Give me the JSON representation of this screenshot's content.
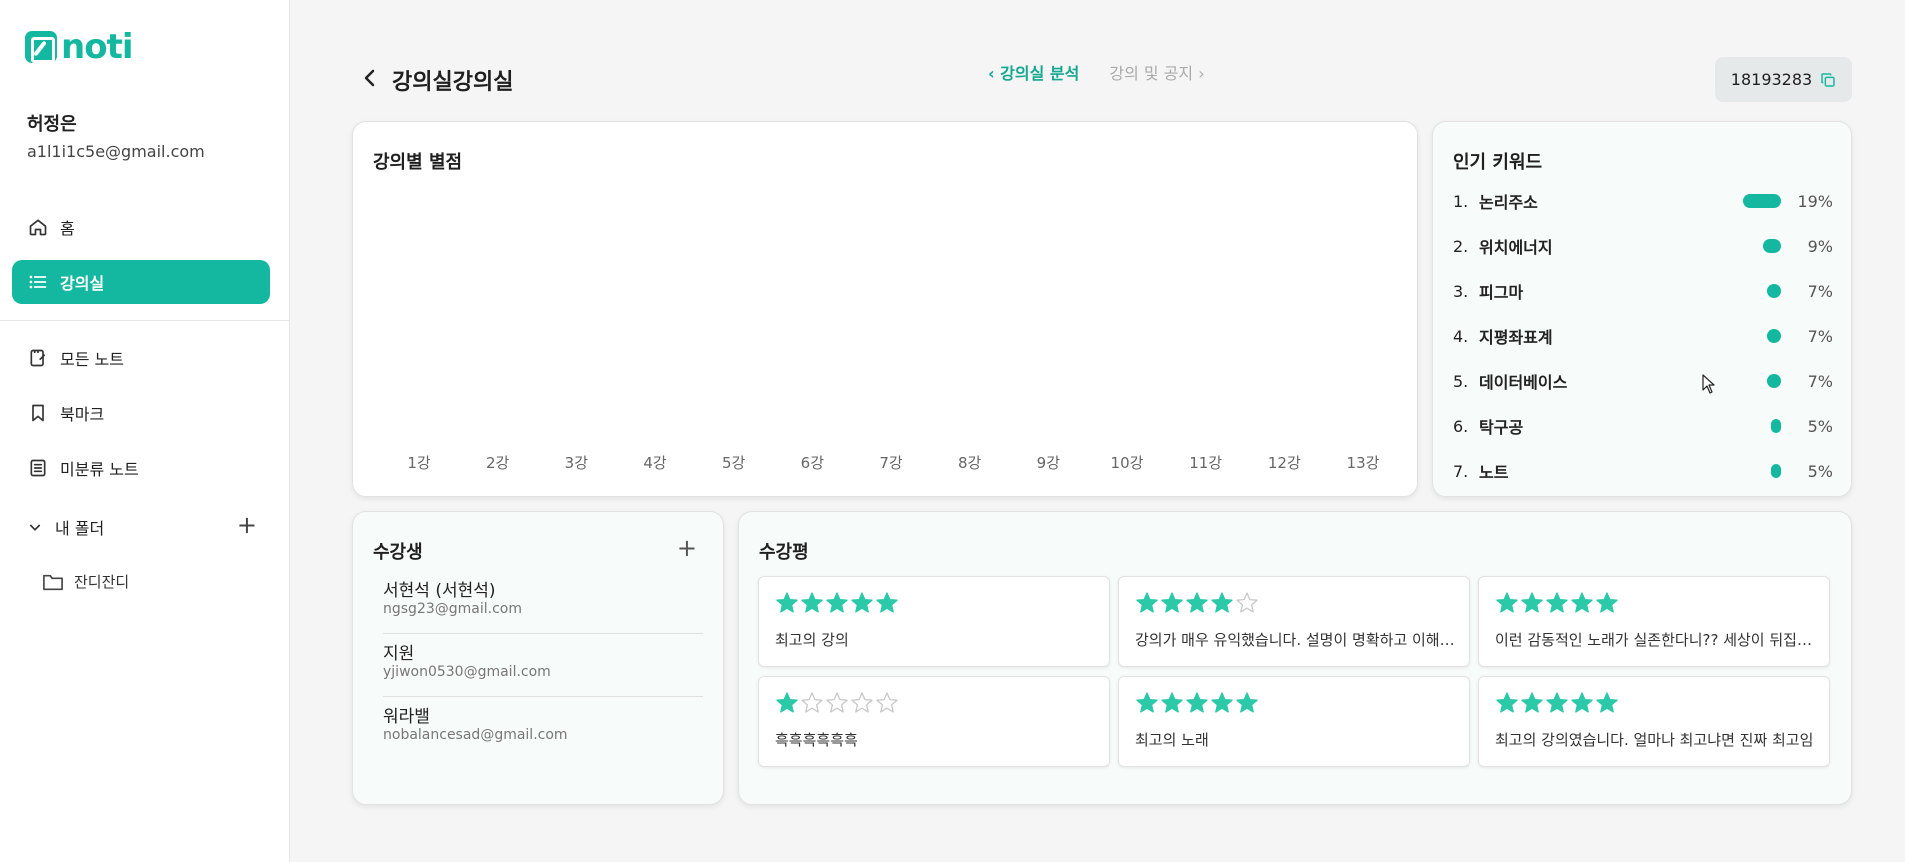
{
  "app": {
    "logo_text": "noti",
    "brand_color": "#14b8a0"
  },
  "user": {
    "name": "허정은",
    "email": "a1l1i1c5e@gmail.com"
  },
  "sidebar": {
    "items": [
      {
        "label": "홈",
        "icon": "home-icon"
      },
      {
        "label": "강의실",
        "icon": "list-icon",
        "active": true
      },
      {
        "label": "모든 노트",
        "icon": "note-icon"
      },
      {
        "label": "북마크",
        "icon": "bookmark-icon"
      },
      {
        "label": "미분류 노트",
        "icon": "notebook-icon"
      }
    ],
    "folder_header": "내 폴더",
    "folders": [
      {
        "label": "잔디잔디"
      }
    ]
  },
  "header": {
    "title": "강의실강의실",
    "tabs": [
      {
        "label": "강의실 분석",
        "active": true
      },
      {
        "label": "강의 및 공지",
        "active": false
      }
    ],
    "code": "18193283"
  },
  "chart": {
    "title": "강의별 별점"
  },
  "chart_data": {
    "type": "bar",
    "categories": [
      "1강",
      "2강",
      "3강",
      "4강",
      "5강",
      "6강",
      "7강",
      "8강",
      "9강",
      "10강",
      "11강",
      "12강",
      "13강"
    ],
    "values": [],
    "title": "강의별 별점"
  },
  "keywords": {
    "title": "인기 키워드",
    "items": [
      {
        "rank": "1.",
        "name": "논리주소",
        "pct": "19%",
        "value": 19
      },
      {
        "rank": "2.",
        "name": "위치에너지",
        "pct": "9%",
        "value": 9
      },
      {
        "rank": "3.",
        "name": "피그마",
        "pct": "7%",
        "value": 7
      },
      {
        "rank": "4.",
        "name": "지평좌표계",
        "pct": "7%",
        "value": 7
      },
      {
        "rank": "5.",
        "name": "데이터베이스",
        "pct": "7%",
        "value": 7
      },
      {
        "rank": "6.",
        "name": "탁구공",
        "pct": "5%",
        "value": 5
      },
      {
        "rank": "7.",
        "name": "노트",
        "pct": "5%",
        "value": 5
      }
    ]
  },
  "students": {
    "title": "수강생",
    "items": [
      {
        "name": "서현석 (서현석)",
        "email": "ngsg23@gmail.com"
      },
      {
        "name": "지원",
        "email": "yjiwon0530@gmail.com"
      },
      {
        "name": "워라밸",
        "email": "nobalancesad@gmail.com"
      }
    ]
  },
  "reviews": {
    "title": "수강평",
    "items": [
      {
        "rating": 5,
        "text": "최고의 강의"
      },
      {
        "rating": 4,
        "text": "강의가 매우 유익했습니다. 설명이 명확하고 이해하…"
      },
      {
        "rating": 5,
        "text": "이런 감동적인 노래가 실존한다니?? 세상이 뒤집히…"
      },
      {
        "rating": 1,
        "text": "흑흑흑흑흑흑"
      },
      {
        "rating": 5,
        "text": "최고의 노래"
      },
      {
        "rating": 5,
        "text": "최고의 강의였습니다. 얼마나 최고냐면 진짜 최고임"
      }
    ]
  }
}
